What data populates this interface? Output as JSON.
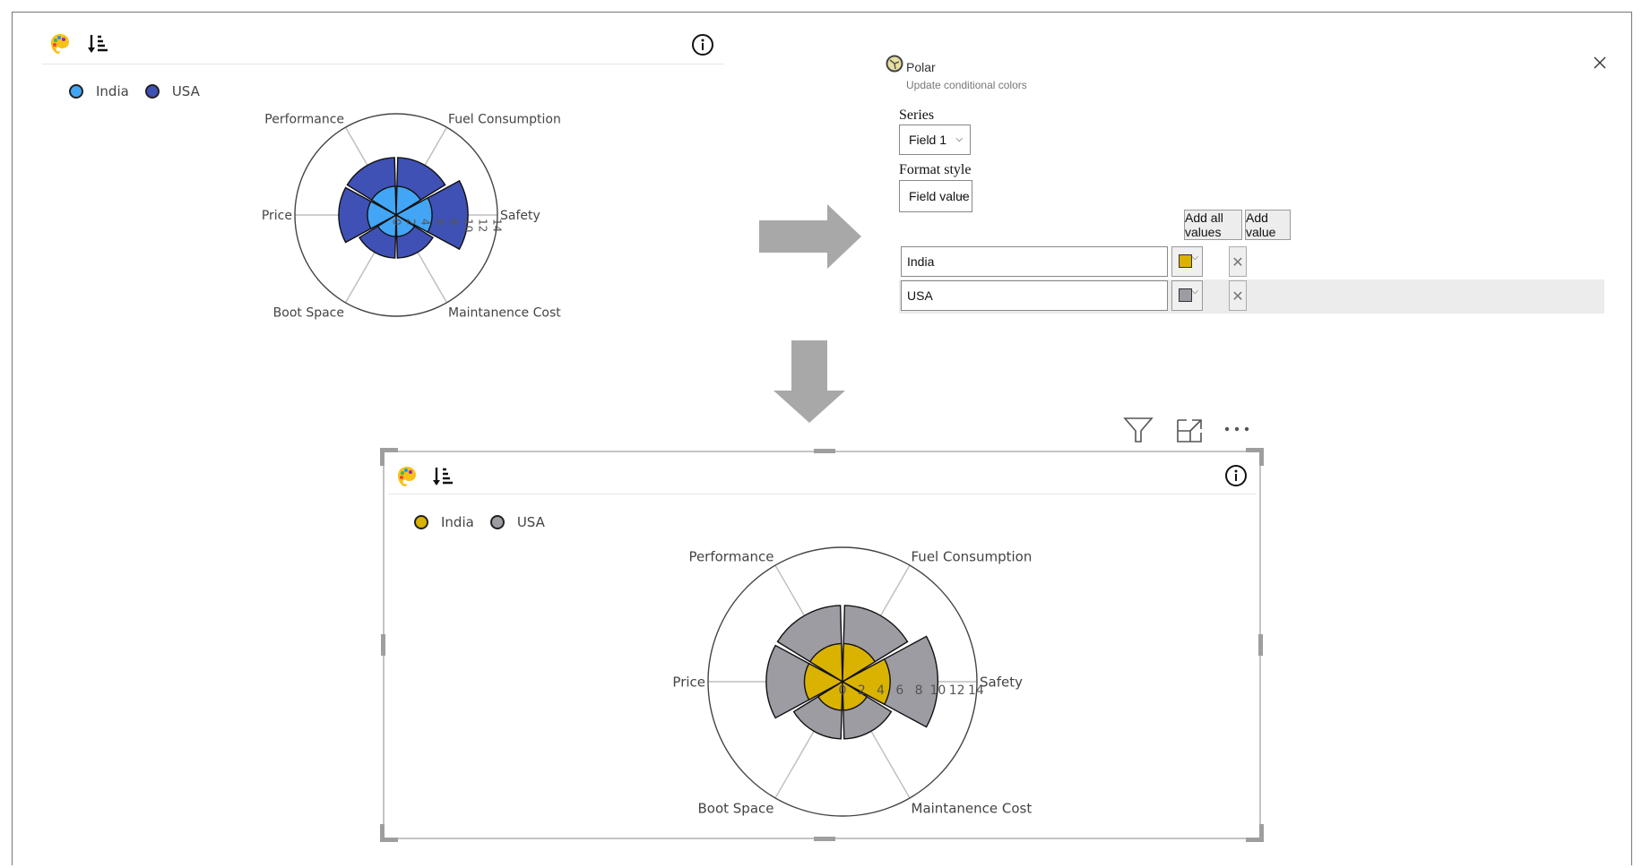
{
  "top_visual": {
    "legend": [
      {
        "label": "India",
        "color": "#42a5f5"
      },
      {
        "label": "USA",
        "color": "#3f51b5"
      }
    ],
    "icons": [
      "palette-icon",
      "sort-icon",
      "info-icon"
    ]
  },
  "panel": {
    "title": "Polar",
    "subtitle": "Update conditional colors",
    "series_label": "Series",
    "series_value": "Field 1",
    "format_style_label": "Format style",
    "format_style_value": "Field value",
    "add_all_values_label": "Add all values",
    "add_value_label": "Add value",
    "rows": [
      {
        "value": "India",
        "color": "#dab200"
      },
      {
        "value": "USA",
        "color": "#9d9ca3"
      }
    ],
    "close_icon": "close-icon"
  },
  "bottom_visual": {
    "legend": [
      {
        "label": "India",
        "color": "#dab200"
      },
      {
        "label": "USA",
        "color": "#9d9ca3"
      }
    ],
    "toolbar_icons": [
      "filter-icon",
      "focus-mode-icon",
      "more-options-icon"
    ]
  },
  "chart_data": [
    {
      "type": "barpolar",
      "categories": [
        "Safety",
        "Fuel Consumption",
        "Performance",
        "Price",
        "Boot Space",
        "Maintanence Cost"
      ],
      "series": [
        {
          "name": "USA",
          "values": [
            10,
            8,
            8,
            8,
            6,
            6
          ],
          "color": "#3f51b5"
        },
        {
          "name": "India",
          "values": [
            5,
            4,
            4,
            4,
            3,
            3
          ],
          "color": "#42a5f5"
        }
      ],
      "radial_ticks": [
        "0",
        "2",
        "4",
        "6",
        "8",
        "10",
        "12",
        "14"
      ],
      "radial_range": [
        0,
        14.1
      ],
      "radial_tick_orientation": "vertical",
      "legend": "top-left"
    },
    {
      "type": "barpolar",
      "categories": [
        "Safety",
        "Fuel Consumption",
        "Performance",
        "Price",
        "Boot Space",
        "Maintanence Cost"
      ],
      "series": [
        {
          "name": "USA",
          "values": [
            10,
            8,
            8,
            8,
            6,
            6
          ],
          "color": "#9d9ca3"
        },
        {
          "name": "India",
          "values": [
            5,
            4,
            4,
            4,
            3,
            3
          ],
          "color": "#dab200"
        }
      ],
      "radial_ticks": [
        "0",
        "2",
        "4",
        "6",
        "8",
        "10",
        "12",
        "14"
      ],
      "radial_range": [
        0,
        14.1
      ],
      "radial_tick_orientation": "horizontal",
      "legend": "top-left"
    }
  ]
}
